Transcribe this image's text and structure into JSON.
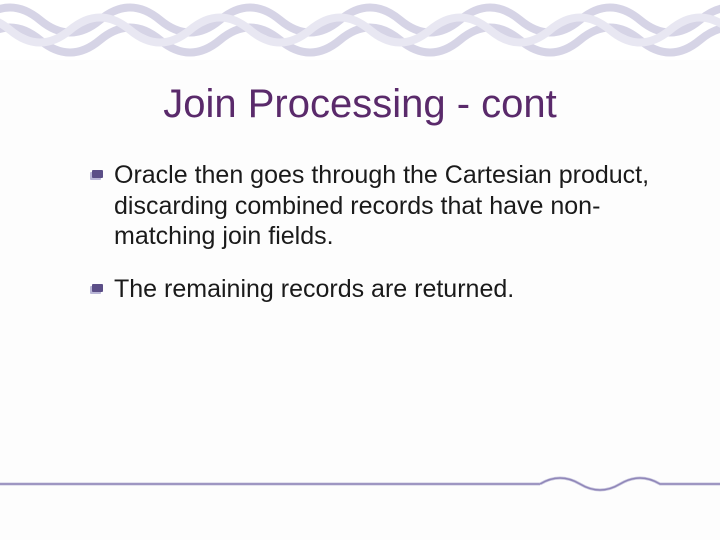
{
  "title": "Join Processing - cont",
  "bullets": [
    "Oracle then goes through the Cartesian product, discarding combined records that have non-matching join fields.",
    "The remaining records are returned."
  ]
}
